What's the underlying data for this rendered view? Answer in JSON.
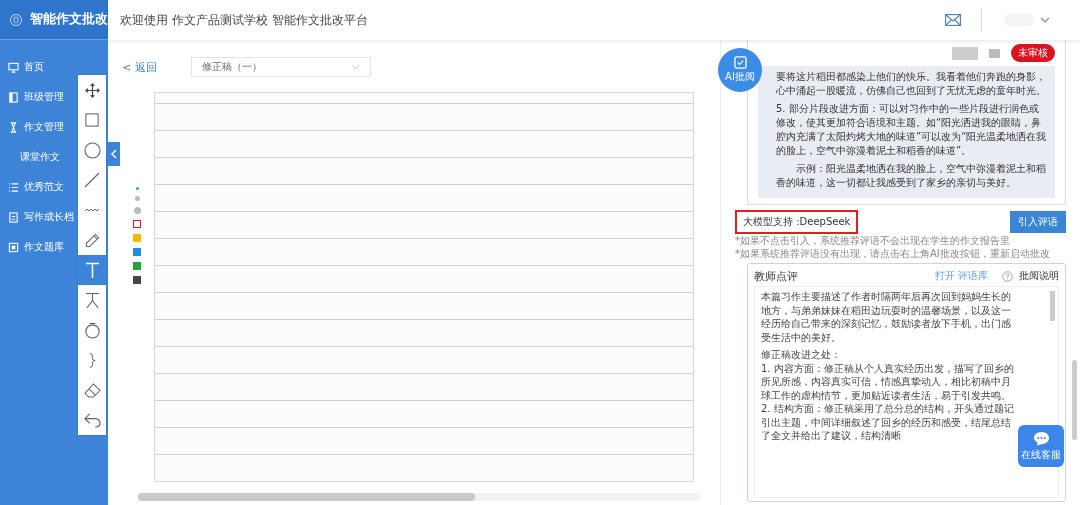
{
  "brand": {
    "title": "智能作文批改"
  },
  "header": {
    "welcome": "欢迎使用 作文产品测试学校 智能作文批改平台"
  },
  "sidebar": {
    "items": [
      {
        "label": "首页",
        "kind": "monitor"
      },
      {
        "label": "班级管理",
        "kind": "book"
      },
      {
        "label": "作文管理",
        "kind": "hourglass"
      },
      {
        "label": "课堂作文",
        "kind": "sub"
      },
      {
        "label": "优秀范文",
        "kind": "list"
      },
      {
        "label": "写作成长档",
        "kind": "file"
      },
      {
        "label": "作文题库",
        "kind": "box"
      }
    ]
  },
  "toolbar": {
    "back": "< 返回",
    "draft": "修正稿（一）"
  },
  "tools": [
    {
      "kind": "move",
      "selected": false
    },
    {
      "kind": "rect",
      "selected": false
    },
    {
      "kind": "circle",
      "selected": false
    },
    {
      "kind": "line",
      "selected": false
    },
    {
      "kind": "wave",
      "selected": false
    },
    {
      "kind": "pencil",
      "selected": false
    },
    {
      "kind": "text",
      "selected": true
    },
    {
      "kind": "caret",
      "selected": false
    },
    {
      "kind": "ring",
      "selected": false
    },
    {
      "kind": "brace",
      "selected": false
    },
    {
      "kind": "eraser",
      "selected": false
    },
    {
      "kind": "undo",
      "selected": false
    }
  ],
  "sizes": [
    {
      "selected": true
    },
    {
      "selected": false
    },
    {
      "selected": false
    }
  ],
  "colors": [
    {
      "color": "#e02020",
      "selected": true
    },
    {
      "color": "#f5b800",
      "selected": false
    },
    {
      "color": "#1e90e0",
      "selected": false
    },
    {
      "color": "#22a63a",
      "selected": false
    },
    {
      "color": "#444444",
      "selected": false
    }
  ],
  "review": {
    "ai_button": "AI批阅",
    "status": "未审核",
    "ai_text": [
      "要将这片稻田都感染上他们的快乐。我看着他们奔跑的身影，心中涌起一股暖流，仿佛自己也回到了无忧无虑的童年时光。",
      "5. 部分片段改进方面：可以对习作中的一些片段进行润色或修改，使其更加符合语境和主题。如“阳光洒进我的眼睛，鼻腔内充满了太阳灼烤大地的味道”可以改为“阳光温柔地洒在我的脸上，空气中弥漫着泥土和稻香的味道”。",
      "　　示例：阳光温柔地洒在我的脸上，空气中弥漫着泥土和稻香的味道，这一切都让我感受到了家乡的亲切与美好。"
    ]
  },
  "model": {
    "label": "大模型支持 :DeepSeek",
    "button": "引入评语"
  },
  "notes": [
    "*如果不点击引入，系统推荐评语不会出现在学生的作文报告里",
    "*如果系统推荐评语没有出现，请点击右上角AI批改按钮，重新启动批改"
  ],
  "teacher": {
    "title": "教师点评",
    "open": "打开 评语库",
    "help": "批阅说明",
    "paragraphs": [
      "本篇习作主要描述了作者时隔两年后再次回到妈妈生长的地方，与弟弟妹妹在稻田边玩耍时的温馨场景，以及这一经历给自己带来的深刻记忆，鼓励读者放下手机，出门感受生活中的美好。",
      "修正稿改进之处：",
      "1. 内容方面：修正稿从个人真实经历出发，描写了回乡的所见所感，内容真实可信，情感真挚动人，相比初稿中月球工作的虚构情节，更加贴近读者生活，易于引发共鸣。",
      "2. 结构方面：修正稿采用了总分总的结构，开头通过题记引出主题，中间详细叙述了回乡的经历和感受，结尾总结了全文并给出了建议，结构清晰"
    ]
  },
  "chat": {
    "label": "在线客服"
  }
}
